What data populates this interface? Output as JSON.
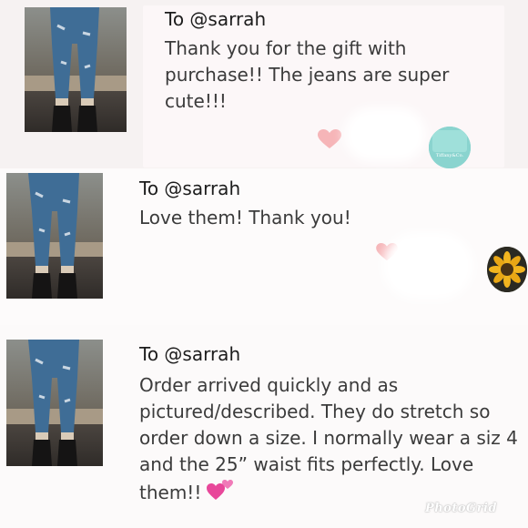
{
  "reviews": [
    {
      "to": "To @sarrah",
      "text": "Thank you for the gift with purchase!! The jeans are super cute!!!",
      "avatar_text": "Tiffany&Co."
    },
    {
      "to": "To @sarrah",
      "text": "Love them! Thank you!"
    },
    {
      "to": "To @sarrah",
      "text": "Order arrived quickly and as pictured/described. They do stretch so order down a size. I normally wear a siz 4 and the 25” waist fits perfectly. Love them!!"
    }
  ],
  "watermark": "PhotoGrid",
  "colors": {
    "heart": "#f6b5b8",
    "hearts_emoji": "#e8479a",
    "tiffany_blue": "#7fcfc9"
  },
  "icons": {
    "like": "heart-icon",
    "emoji": "two-hearts-icon"
  }
}
